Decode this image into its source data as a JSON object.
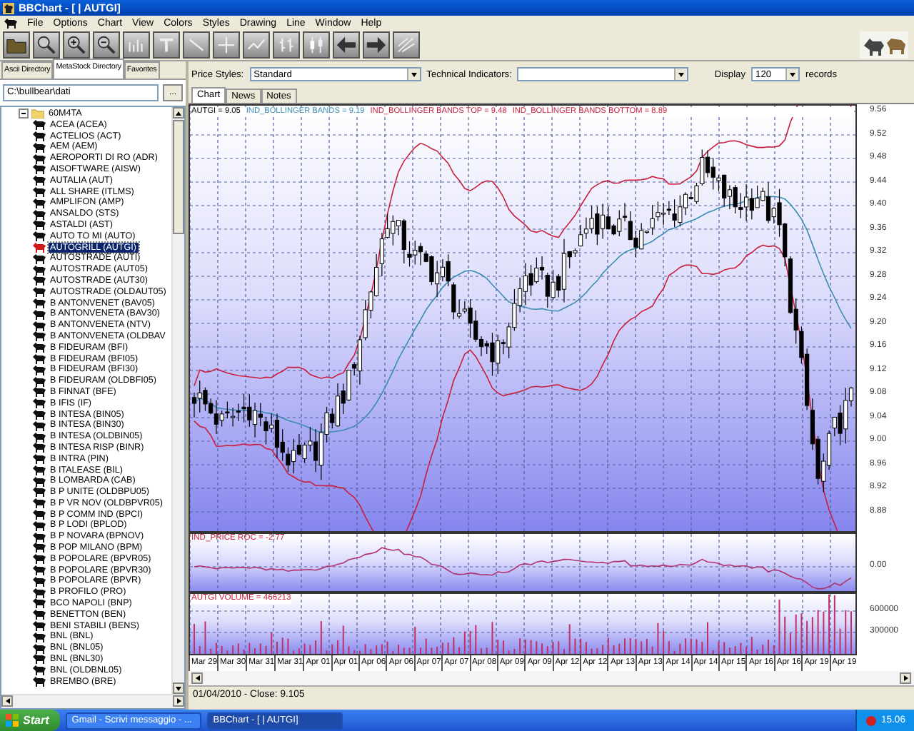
{
  "window": {
    "title": "BBChart - [ | AUTGI]"
  },
  "menu": [
    "File",
    "Options",
    "Chart",
    "View",
    "Colors",
    "Styles",
    "Drawing",
    "Line",
    "Window",
    "Help"
  ],
  "left_panel": {
    "tabs": [
      {
        "label": "Ascii Directory",
        "selected": false
      },
      {
        "label": "MetaStock Directory",
        "selected": true
      },
      {
        "label": "Favorites",
        "selected": false
      }
    ],
    "path": {
      "value": "C:\\bullbear\\dati"
    },
    "browse_button": "...",
    "tree": [
      {
        "label": "60M4TA",
        "expanded": true,
        "children": [
          {
            "label": "ACEA (ACEA)",
            "selected": false
          },
          {
            "label": "ACTELIOS (ACT)",
            "selected": false
          },
          {
            "label": "AEM (AEM)",
            "selected": false
          },
          {
            "label": "AEROPORTI DI RO (ADR)",
            "selected": false
          },
          {
            "label": "AISOFTWARE (AISW)",
            "selected": false
          },
          {
            "label": "AUTALIA (AUT)",
            "selected": false
          },
          {
            "label": "ALL SHARE (ITLMS)",
            "selected": false
          },
          {
            "label": "AMPLIFON (AMP)",
            "selected": false
          },
          {
            "label": "ANSALDO (STS)",
            "selected": false
          },
          {
            "label": "ASTALDI (AST)",
            "selected": false
          },
          {
            "label": "AUTO TO MI (AUTO)",
            "selected": false
          },
          {
            "label": "AUTOGRILL (AUTGI)",
            "selected": true
          },
          {
            "label": "AUTOSTRADE (AUTI)",
            "selected": false
          },
          {
            "label": "AUTOSTRADE (AUT05)",
            "selected": false
          },
          {
            "label": "AUTOSTRADE (AUT30)",
            "selected": false
          },
          {
            "label": "AUTOSTRADE (OLDAUT05)",
            "selected": false
          },
          {
            "label": "B ANTONVENET (BAV05)",
            "selected": false
          },
          {
            "label": "B ANTONVENETA (BAV30)",
            "selected": false
          },
          {
            "label": "B ANTONVENETA (NTV)",
            "selected": false
          },
          {
            "label": "B ANTONVENETA (OLDBAV",
            "selected": false
          },
          {
            "label": "B FIDEURAM (BFI)",
            "selected": false
          },
          {
            "label": "B FIDEURAM (BFI05)",
            "selected": false
          },
          {
            "label": "B FIDEURAM (BFI30)",
            "selected": false
          },
          {
            "label": "B FIDEURAM (OLDBFI05)",
            "selected": false
          },
          {
            "label": "B FINNAT (BFE)",
            "selected": false
          },
          {
            "label": "B IFIS (IF)",
            "selected": false
          },
          {
            "label": "B INTESA (BIN05)",
            "selected": false
          },
          {
            "label": "B INTESA (BIN30)",
            "selected": false
          },
          {
            "label": "B INTESA (OLDBIN05)",
            "selected": false
          },
          {
            "label": "B INTESA RISP (BINR)",
            "selected": false
          },
          {
            "label": "B INTRA (PIN)",
            "selected": false
          },
          {
            "label": "B ITALEASE (BIL)",
            "selected": false
          },
          {
            "label": "B LOMBARDA (CAB)",
            "selected": false
          },
          {
            "label": "B P UNITE (OLDBPU05)",
            "selected": false
          },
          {
            "label": "B P VR NOV (OLDBPVR05)",
            "selected": false
          },
          {
            "label": "B P COMM IND (BPCI)",
            "selected": false
          },
          {
            "label": "B P LODI (BPLOD)",
            "selected": false
          },
          {
            "label": "B P NOVARA (BPNOV)",
            "selected": false
          },
          {
            "label": "B POP MILANO (BPM)",
            "selected": false
          },
          {
            "label": "B POPOLARE (BPVR05)",
            "selected": false
          },
          {
            "label": "B POPOLARE (BPVR30)",
            "selected": false
          },
          {
            "label": "B POPOLARE (BPVR)",
            "selected": false
          },
          {
            "label": "B PROFILO (PRO)",
            "selected": false
          },
          {
            "label": "BCO NAPOLI (BNP)",
            "selected": false
          },
          {
            "label": "BENETTON (BEN)",
            "selected": false
          },
          {
            "label": "BENI STABILI (BENS)",
            "selected": false
          },
          {
            "label": "BNL (BNL)",
            "selected": false
          },
          {
            "label": "BNL (BNL05)",
            "selected": false
          },
          {
            "label": "BNL (BNL30)",
            "selected": false
          },
          {
            "label": "BNL (OLDBNL05)",
            "selected": false
          },
          {
            "label": "BREMBO (BRE)",
            "selected": false
          }
        ]
      }
    ]
  },
  "controls": {
    "price_styles": {
      "label": "Price Styles:",
      "value": "Standard"
    },
    "technical_indicators": {
      "label": "Technical Indicators:"
    },
    "display": {
      "label": "Display",
      "value": "120",
      "suffix": "records"
    }
  },
  "chart_tabs": [
    {
      "label": "Chart",
      "selected": true
    },
    {
      "label": "News",
      "selected": false
    },
    {
      "label": "Notes",
      "selected": false
    }
  ],
  "price_panel": {
    "legend": [
      {
        "text": "AUTGI = 9.05",
        "color": "#000000"
      },
      {
        "text": "IND_BOLLINGER BANDS = 9.19",
        "color": "#3a8cb0"
      },
      {
        "text": "IND_BOLLINGER BANDS TOP = 9.48",
        "color": "#c8203c"
      },
      {
        "text": "IND_BOLLINGER BANDS BOTTOM = 8.89",
        "color": "#c8203c"
      }
    ],
    "y_labels": [
      "9.56",
      "9.52",
      "9.48",
      "9.44",
      "9.40",
      "9.36",
      "9.32",
      "9.28",
      "9.24",
      "9.20",
      "9.16",
      "9.12",
      "9.08",
      "9.04",
      "9.00",
      "8.96",
      "8.92",
      "8.88"
    ]
  },
  "roc_panel": {
    "legend": "IND_PRICE ROC = -2.77",
    "y_labels": [
      "0.00"
    ]
  },
  "volume_panel": {
    "legend": "AUTGI VOLUME = 466213",
    "y_labels": [
      "600000",
      "300000"
    ]
  },
  "x_labels": [
    "Mar 29",
    "Mar 30",
    "Mar 31",
    "Mar 31",
    "Apr 01",
    "Apr 01",
    "Apr 06",
    "Apr 06",
    "Apr 07",
    "Apr 07",
    "Apr 08",
    "Apr 09",
    "Apr 09",
    "Apr 12",
    "Apr 12",
    "Apr 13",
    "Apr 13",
    "Apr 14",
    "Apr 14",
    "Apr 15",
    "Apr 16",
    "Apr 16",
    "Apr 19",
    "Apr 19"
  ],
  "status_bar": "01/04/2010 - Close: 9.105",
  "taskbar": {
    "start": "Start",
    "tasks": [
      {
        "label": "Gmail - Scrivi messaggio - ...",
        "selected": false
      },
      {
        "label": "BBChart - [ | AUTGI]",
        "selected": true
      }
    ],
    "clock": "15.06"
  }
}
